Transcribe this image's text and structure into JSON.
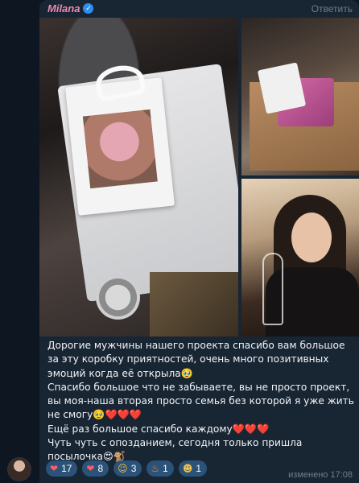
{
  "message": {
    "author": "Milana",
    "reply_label": "Ответить",
    "paragraphs": [
      "Дорогие мужчины нашего проекта спасибо вам большое за эту коробку приятностей, очень много позитивных эмоций когда её открыла🥹",
      "Спасибо большое что не забываете, вы не просто проект, вы моя-наша вторая просто семья без которой я уже жить не смогу🥹❤️❤️❤️",
      "Ещё раз большое спасибо каждому❤️❤️❤️",
      "Чуть чуть с опозданием, сегодня только пришла посылочка😍🐒"
    ],
    "edited_label": "изменено",
    "time": "17:08"
  },
  "reactions": [
    {
      "icon": "heart-on-fire",
      "glyph": "❤",
      "count": "17"
    },
    {
      "icon": "red-heart",
      "glyph": "❤",
      "count": "8"
    },
    {
      "icon": "smiling-face-with-hearts",
      "glyph": "☺",
      "count": "3"
    },
    {
      "icon": "fire",
      "glyph": "♨",
      "count": "1"
    },
    {
      "icon": "grinning-face-with-sweat",
      "glyph": "☻",
      "count": "1"
    }
  ],
  "colors": {
    "background": "#0e1621",
    "bubble": "#182533",
    "author": "#e98bb0",
    "reaction_bg": "#2b5278",
    "meta": "#6d7f8f"
  }
}
